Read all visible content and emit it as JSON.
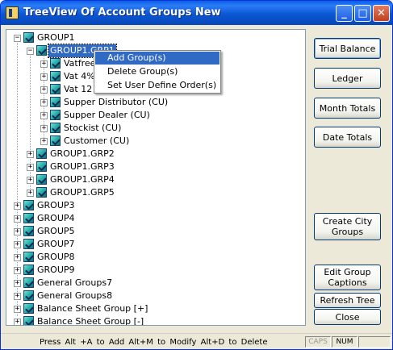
{
  "window": {
    "title": "TreeView Of Account Groups New"
  },
  "title_buttons": {
    "minimize": "_",
    "maximize": "□",
    "close": "✕"
  },
  "tree": {
    "nodes": [
      {
        "label": "GROUP1",
        "expander": "−"
      },
      {
        "label": "GROUP1.GRP1",
        "expander": "−"
      },
      {
        "label": "Vatfree",
        "expander": "+"
      },
      {
        "label": "Vat 4%",
        "expander": "+"
      },
      {
        "label": "Vat 12",
        "expander": "+"
      },
      {
        "label": "Supper Distributor (CU)",
        "expander": "+"
      },
      {
        "label": "Supper Dealer (CU)",
        "expander": "+"
      },
      {
        "label": "Stockist (CU)",
        "expander": "+"
      },
      {
        "label": "Customer (CU)",
        "expander": "+"
      },
      {
        "label": "GROUP1.GRP2",
        "expander": "+"
      },
      {
        "label": "GROUP1.GRP3",
        "expander": "+"
      },
      {
        "label": "GROUP1.GRP4",
        "expander": "+"
      },
      {
        "label": "GROUP1.GRP5",
        "expander": "+"
      },
      {
        "label": "GROUP3",
        "expander": "+"
      },
      {
        "label": "GROUP4",
        "expander": "+"
      },
      {
        "label": "GROUP5",
        "expander": "+"
      },
      {
        "label": "GROUP7",
        "expander": "+"
      },
      {
        "label": "GROUP8",
        "expander": "+"
      },
      {
        "label": "GROUP9",
        "expander": "+"
      },
      {
        "label": "General Groups7",
        "expander": "+"
      },
      {
        "label": "General Groups8",
        "expander": "+"
      },
      {
        "label": "Balance Sheet Group [+]",
        "expander": "+"
      },
      {
        "label": "Balance Sheet Group [-]",
        "expander": "+"
      }
    ]
  },
  "context_menu": {
    "items": [
      "Add Group(s)",
      "Delete Group(s)",
      "Set User Define Order(s)"
    ]
  },
  "buttons": {
    "trial_balance": "Trial Balance",
    "ledger": "Ledger",
    "month_totals": "Month Totals",
    "date_totals": "Date Totals",
    "create_city_groups": "Create City Groups",
    "edit_group_captions": "Edit Group Captions",
    "refresh_tree": "Refresh Tree",
    "close": "Close"
  },
  "status": {
    "hint": "Press  Alt +A to Add   Alt+M to Modify  Alt+D to Delete",
    "caps": "CAPS",
    "num": "NUM"
  },
  "colors": {
    "title_bar": "#0a57d4",
    "selection": "#316ac5",
    "face": "#ece9d8"
  }
}
